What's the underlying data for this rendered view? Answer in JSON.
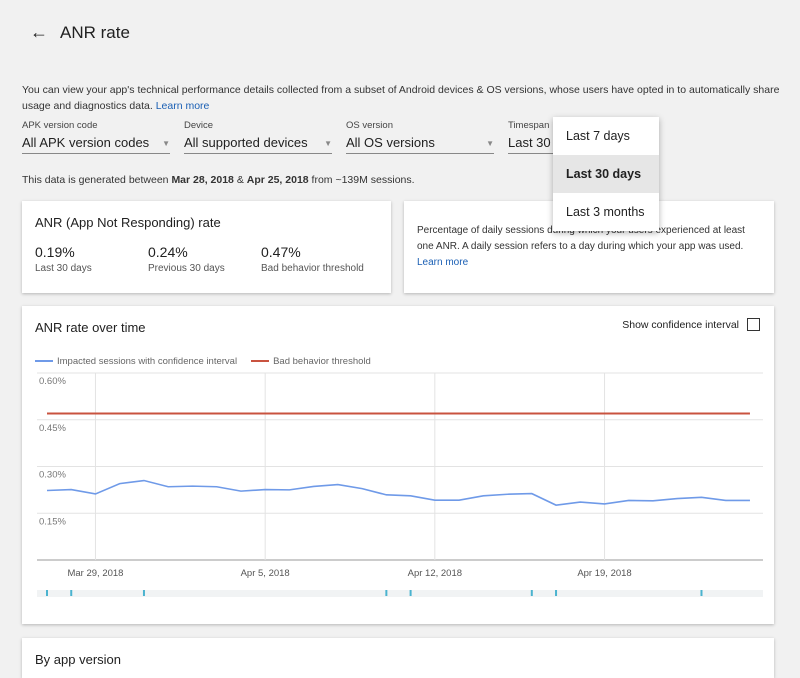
{
  "header": {
    "title": "ANR rate",
    "back_icon": "arrow-left-icon"
  },
  "intro": {
    "text": "You can view your app's technical performance details collected from a subset of Android devices & OS versions, whose users have opted in to automatically share usage and diagnostics data. ",
    "link": "Learn more"
  },
  "filters": [
    {
      "label": "APK version code",
      "value": "All APK version codes"
    },
    {
      "label": "Device",
      "value": "All supported devices"
    },
    {
      "label": "OS version",
      "value": "All OS versions"
    },
    {
      "label": "Timespan",
      "value": "Last 30 days"
    }
  ],
  "timespan_menu": {
    "options": [
      "Last 7 days",
      "Last 30 days",
      "Last 3 months"
    ],
    "selected": "Last 30 days"
  },
  "generated": {
    "pre": "This data is generated between ",
    "start": "Mar 28, 2018",
    "amp": " & ",
    "end": "Apr 25, 2018",
    "post": " from ~139M sessions."
  },
  "anr_card": {
    "title": "ANR (App Not Responding) rate",
    "stats": [
      {
        "value": "0.19%",
        "label": "Last 30 days"
      },
      {
        "value": "0.24%",
        "label": "Previous 30 days"
      },
      {
        "value": "0.47%",
        "label": "Bad behavior threshold"
      }
    ]
  },
  "info_card": {
    "text": "Percentage of daily sessions during which your users experienced at least one ANR. A daily session refers to a day during which your app was used.",
    "link": "Learn more"
  },
  "chart_card": {
    "title": "ANR rate over time",
    "confidence_label": "Show confidence interval"
  },
  "chart_data": {
    "type": "line",
    "title": "ANR rate over time",
    "x_start": "Mar 27, 2018",
    "x_tick_labels": [
      "Mar 29, 2018",
      "Apr 5, 2018",
      "Apr 12, 2018",
      "Apr 19, 2018"
    ],
    "x_tick_days": [
      2,
      9,
      16,
      23
    ],
    "y_tick_labels": [
      "0.60%",
      "0.45%",
      "0.30%",
      "0.15%"
    ],
    "y_ticks": [
      0.6,
      0.45,
      0.3,
      0.15
    ],
    "ylim": [
      0,
      0.6
    ],
    "legend": "top-left",
    "series": [
      {
        "name": "Impacted sessions with confidence interval",
        "color": "#6f9ae8",
        "values": [
          0.223,
          0.226,
          0.212,
          0.245,
          0.255,
          0.235,
          0.237,
          0.235,
          0.221,
          0.226,
          0.225,
          0.236,
          0.242,
          0.229,
          0.209,
          0.206,
          0.192,
          0.192,
          0.206,
          0.211,
          0.213,
          0.176,
          0.186,
          0.18,
          0.191,
          0.19,
          0.197,
          0.201,
          0.191,
          0.191
        ]
      },
      {
        "name": "Bad behavior threshold",
        "color": "#c9533f",
        "values": [
          0.47
        ]
      }
    ],
    "marker_days": [
      0,
      1,
      4,
      14,
      15,
      20,
      21,
      27
    ]
  },
  "next_section": {
    "title": "By app version"
  }
}
